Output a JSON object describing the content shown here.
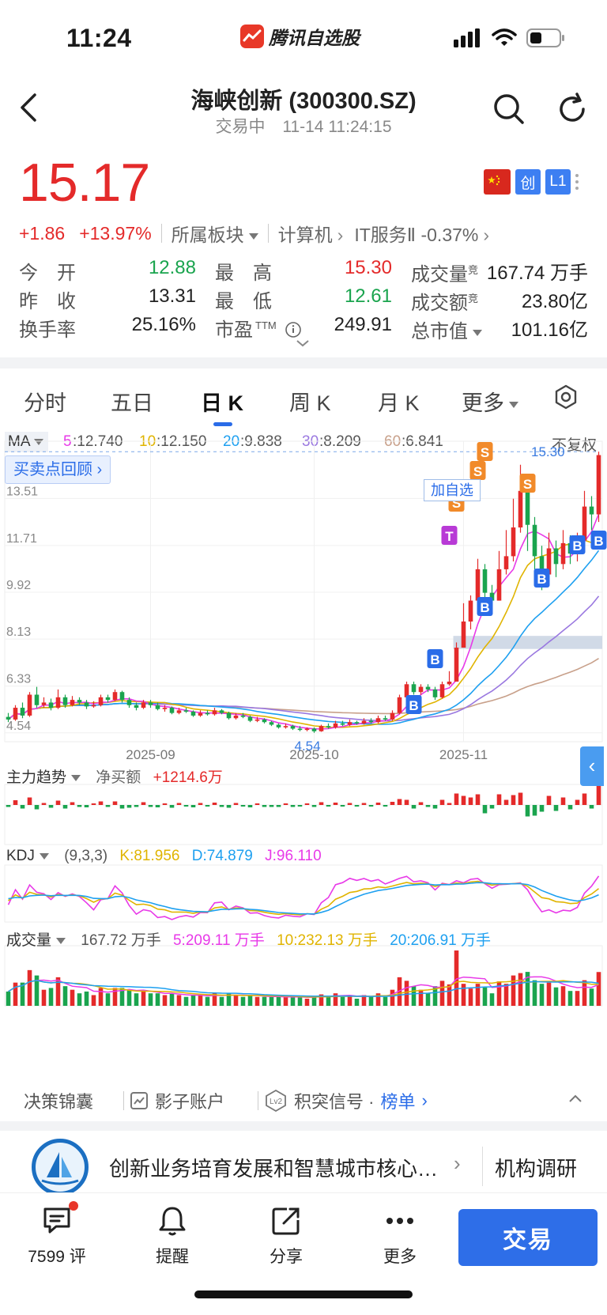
{
  "status_bar": {
    "time": "11:24",
    "app_name": "腾讯自选股"
  },
  "header": {
    "title": "海峡创新 (300300.SZ)",
    "trading_status": "交易中",
    "timestamp": "11-14 11:24:15"
  },
  "quote": {
    "price": "15.17",
    "change": "+1.86",
    "change_pct": "+13.97%",
    "sector_label": "所属板块",
    "sector_1": "计算机",
    "sector_2": "IT服务Ⅱ",
    "sector_2_pct": "-0.37%",
    "badge_board": "创",
    "badge_level": "L1",
    "colors": {
      "up": "#e42a2a",
      "down": "#1aa44e",
      "accent": "#2a6ce8"
    }
  },
  "stats": {
    "open_label": "今　开",
    "open": "12.88",
    "prev_label": "昨　收",
    "prev": "13.31",
    "turnover_label": "换手率",
    "turnover": "25.16%",
    "high_label": "最　高",
    "high": "15.30",
    "low_label": "最　低",
    "low": "12.61",
    "pe_label": "市盈",
    "pe_sup": "TTM",
    "pe": "249.91",
    "volume_label": "成交量",
    "volume": "167.74 万手",
    "amount_label": "成交额",
    "amount": "23.80亿",
    "mcap_label": "总市值",
    "mcap": "101.16亿",
    "bid_mark": "竞"
  },
  "tabs": [
    {
      "label": "分时"
    },
    {
      "label": "五日"
    },
    {
      "label": "日 K",
      "active": true
    },
    {
      "label": "周 K"
    },
    {
      "label": "月 K"
    },
    {
      "label": "更多"
    }
  ],
  "ma_bar": {
    "tag": "MA",
    "ma5_key": "5",
    "ma5": ":12.740",
    "ma10_key": "10",
    "ma10": ":12.150",
    "ma20_key": "20",
    "ma20": ":9.838",
    "ma30_key": "30",
    "ma30": ":8.209",
    "ma60_key": "60",
    "ma60": ":6.841",
    "adjust": "不复权"
  },
  "buy_sell_review": "买卖点回顾",
  "watch_add_label": "加自选",
  "chart_data": {
    "type": "candlestick",
    "price_axis": [
      "13.51",
      "11.71",
      "9.92",
      "8.13",
      "6.33",
      "4.54"
    ],
    "date_axis": [
      "2025-09",
      "2025-10",
      "2025-11"
    ],
    "max_label": "15.30",
    "min_label": "4.54",
    "candles": [
      [
        5.15,
        5.05,
        5.3,
        4.95
      ],
      [
        5.05,
        5.5,
        5.6,
        5.0
      ],
      [
        5.5,
        5.2,
        5.7,
        5.1
      ],
      [
        5.2,
        6.0,
        6.1,
        5.15
      ],
      [
        6.0,
        5.6,
        6.3,
        5.5
      ],
      [
        5.6,
        5.7,
        5.9,
        5.5
      ],
      [
        5.7,
        5.5,
        5.85,
        5.4
      ],
      [
        5.5,
        5.9,
        6.2,
        5.45
      ],
      [
        5.9,
        5.6,
        6.0,
        5.5
      ],
      [
        5.6,
        5.8,
        5.95,
        5.55
      ],
      [
        5.8,
        5.7,
        5.9,
        5.6
      ],
      [
        5.7,
        5.55,
        5.8,
        5.45
      ],
      [
        5.55,
        5.6,
        5.75,
        5.5
      ],
      [
        5.6,
        5.9,
        6.0,
        5.55
      ],
      [
        5.9,
        5.8,
        6.0,
        5.7
      ],
      [
        5.8,
        6.1,
        6.2,
        5.75
      ],
      [
        6.1,
        5.8,
        6.15,
        5.7
      ],
      [
        5.8,
        5.6,
        5.9,
        5.5
      ],
      [
        5.6,
        5.5,
        5.7,
        5.4
      ],
      [
        5.5,
        5.7,
        5.8,
        5.45
      ],
      [
        5.7,
        5.6,
        5.8,
        5.5
      ],
      [
        5.6,
        5.45,
        5.7,
        5.4
      ],
      [
        5.45,
        5.5,
        5.6,
        5.35
      ],
      [
        5.5,
        5.3,
        5.55,
        5.25
      ],
      [
        5.3,
        5.4,
        5.5,
        5.25
      ],
      [
        5.4,
        5.35,
        5.5,
        5.3
      ],
      [
        5.35,
        5.2,
        5.4,
        5.15
      ],
      [
        5.2,
        5.3,
        5.4,
        5.15
      ],
      [
        5.3,
        5.25,
        5.4,
        5.2
      ],
      [
        5.25,
        5.4,
        5.5,
        5.2
      ],
      [
        5.4,
        5.3,
        5.45,
        5.25
      ],
      [
        5.3,
        5.1,
        5.35,
        5.05
      ],
      [
        5.1,
        5.2,
        5.3,
        5.05
      ],
      [
        5.2,
        5.15,
        5.3,
        5.1
      ],
      [
        5.15,
        5.0,
        5.2,
        4.95
      ],
      [
        5.0,
        5.05,
        5.15,
        4.95
      ],
      [
        5.05,
        4.95,
        5.1,
        4.9
      ],
      [
        4.95,
        4.85,
        5.0,
        4.8
      ],
      [
        4.85,
        4.75,
        4.9,
        4.7
      ],
      [
        4.75,
        4.8,
        4.9,
        4.7
      ],
      [
        4.8,
        4.7,
        4.85,
        4.65
      ],
      [
        4.7,
        4.65,
        4.8,
        4.6
      ],
      [
        4.65,
        4.7,
        4.75,
        4.6
      ],
      [
        4.7,
        4.6,
        4.75,
        4.54
      ],
      [
        4.6,
        4.8,
        4.85,
        4.58
      ],
      [
        4.8,
        4.75,
        4.9,
        4.7
      ],
      [
        4.75,
        4.9,
        5.0,
        4.7
      ],
      [
        4.9,
        4.85,
        5.0,
        4.8
      ],
      [
        4.85,
        4.95,
        5.05,
        4.8
      ],
      [
        4.95,
        4.9,
        5.0,
        4.85
      ],
      [
        4.9,
        5.0,
        5.1,
        4.85
      ],
      [
        5.0,
        4.95,
        5.1,
        4.9
      ],
      [
        4.95,
        5.1,
        5.2,
        4.9
      ],
      [
        5.1,
        5.05,
        5.2,
        5.0
      ],
      [
        5.05,
        5.3,
        5.4,
        5.0
      ],
      [
        5.3,
        5.9,
        6.0,
        5.25
      ],
      [
        5.9,
        6.4,
        6.5,
        5.85
      ],
      [
        6.4,
        6.1,
        6.5,
        6.0
      ],
      [
        6.1,
        6.3,
        6.4,
        6.0
      ],
      [
        6.3,
        6.2,
        6.4,
        6.1
      ],
      [
        6.2,
        5.9,
        6.3,
        5.8
      ],
      [
        5.9,
        6.4,
        6.5,
        5.85
      ],
      [
        6.4,
        6.5,
        6.9,
        6.35
      ],
      [
        6.5,
        7.8,
        8.0,
        6.5
      ],
      [
        7.8,
        8.8,
        9.5,
        7.8
      ],
      [
        8.8,
        9.6,
        9.8,
        8.5
      ],
      [
        9.6,
        10.8,
        11.2,
        9.5
      ],
      [
        10.8,
        9.9,
        11.0,
        9.6
      ],
      [
        9.9,
        9.6,
        10.2,
        9.3
      ],
      [
        9.6,
        10.8,
        11.5,
        9.6
      ],
      [
        10.8,
        11.3,
        12.3,
        10.6
      ],
      [
        11.3,
        12.4,
        13.5,
        11.1
      ],
      [
        12.4,
        13.8,
        14.8,
        12.2
      ],
      [
        13.8,
        12.5,
        14.2,
        11.5
      ],
      [
        12.5,
        11.3,
        12.8,
        10.8
      ],
      [
        11.3,
        10.6,
        11.7,
        10.0
      ],
      [
        10.6,
        11.6,
        12.2,
        10.4
      ],
      [
        11.6,
        11.0,
        11.9,
        10.5
      ],
      [
        11.0,
        11.8,
        12.3,
        10.8
      ],
      [
        11.8,
        11.4,
        12.1,
        11.0
      ],
      [
        11.4,
        11.9,
        12.2,
        11.1
      ],
      [
        11.9,
        13.2,
        13.8,
        11.8
      ],
      [
        13.2,
        12.9,
        13.6,
        12.3
      ],
      [
        12.9,
        15.17,
        15.3,
        12.61
      ]
    ],
    "indicators": {
      "main_flow": {
        "label": "主力趋势",
        "sub": "净买额",
        "value": "+1214.6万"
      },
      "kdj": {
        "label": "KDJ",
        "params": "(9,3,3)",
        "k": "K:81.956",
        "d": "D:74.879",
        "j": "J:96.110"
      },
      "volume": {
        "label": "成交量",
        "total": "167.72 万手",
        "ma5": "5:209.11 万手",
        "ma10": "10:232.13 万手",
        "ma20": "20:206.91 万手"
      }
    }
  },
  "tools": {
    "tool1": "决策锦囊",
    "tool2": "影子账户",
    "tool3_prefix": "积突信号 · ",
    "tool3_link": "榜单"
  },
  "news": {
    "headline": "创新业务培育发展和智慧城市核心…",
    "tag": "机构调研"
  },
  "bottom_bar": {
    "comments": "7599 评",
    "remind": "提醒",
    "share": "分享",
    "more": "更多",
    "trade": "交易"
  }
}
